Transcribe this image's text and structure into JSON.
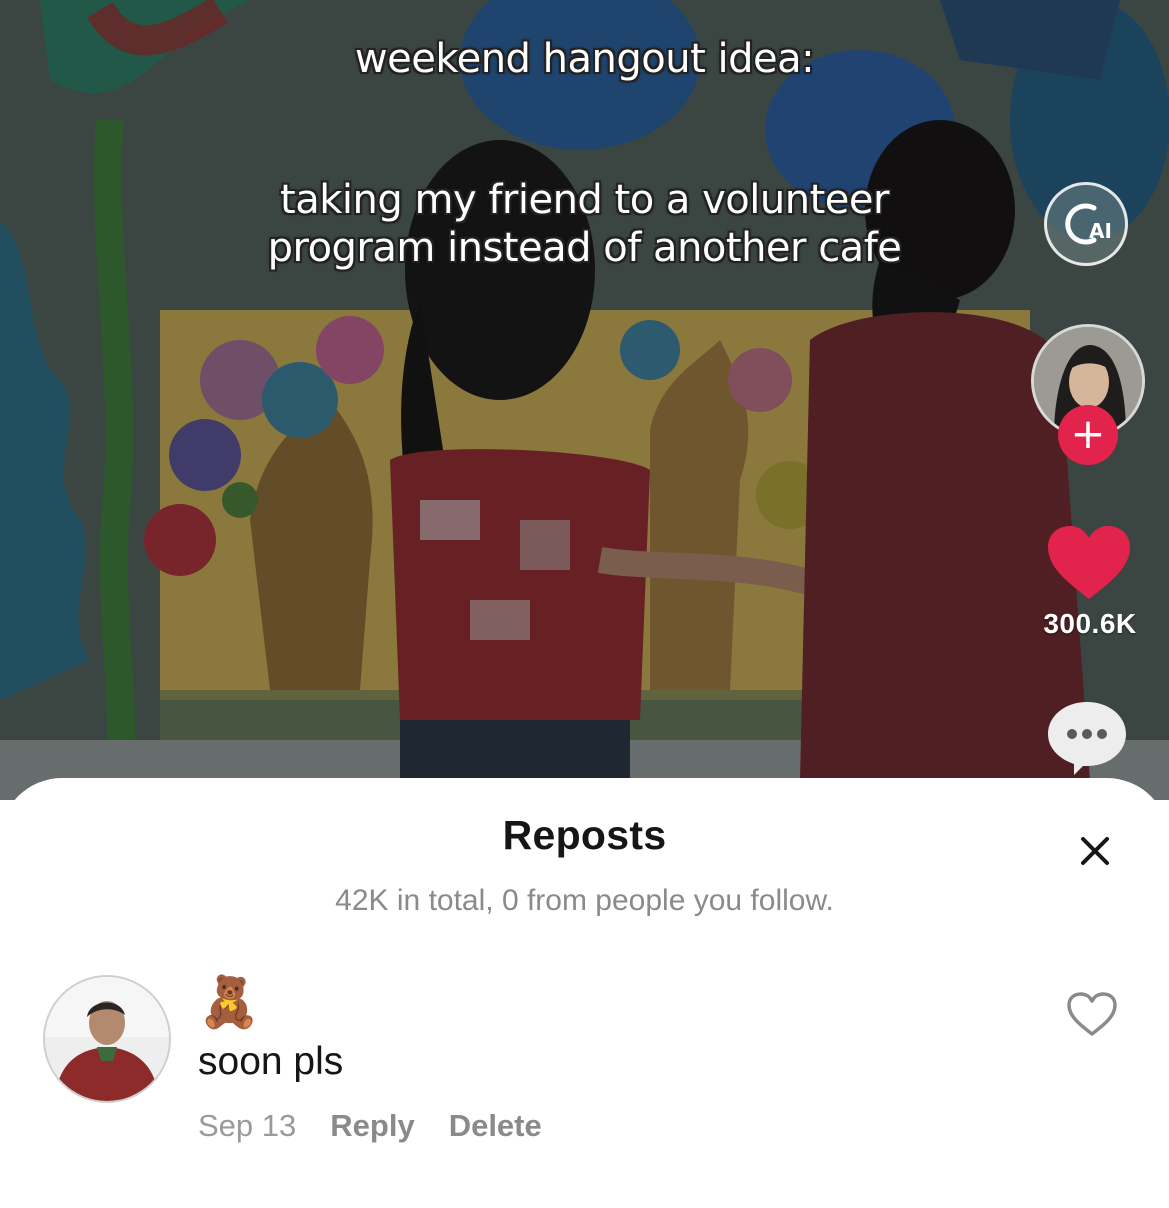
{
  "video": {
    "caption_line1": "weekend hangout idea:",
    "caption_line2a": "taking my friend to a volunteer",
    "caption_line2b": "program instead of another cafe",
    "ai_badge_label": "AI",
    "like_count": "300.6K",
    "follow_symbol": "+"
  },
  "sheet": {
    "title": "Reposts",
    "subtitle": "42K in total, 0 from people you follow.",
    "close_symbol": "×"
  },
  "comment": {
    "username": "🧸",
    "text": "soon pls",
    "date": "Sep 13",
    "reply_label": "Reply",
    "delete_label": "Delete"
  },
  "icons": {
    "close": "close-icon",
    "heart": "heart-icon",
    "comment": "comment-icon",
    "ai": "ai-badge-icon",
    "follow": "plus-icon"
  },
  "colors": {
    "like_red": "#e2234b",
    "subtitle_gray": "#8a8a8a",
    "title_black": "#161616"
  }
}
